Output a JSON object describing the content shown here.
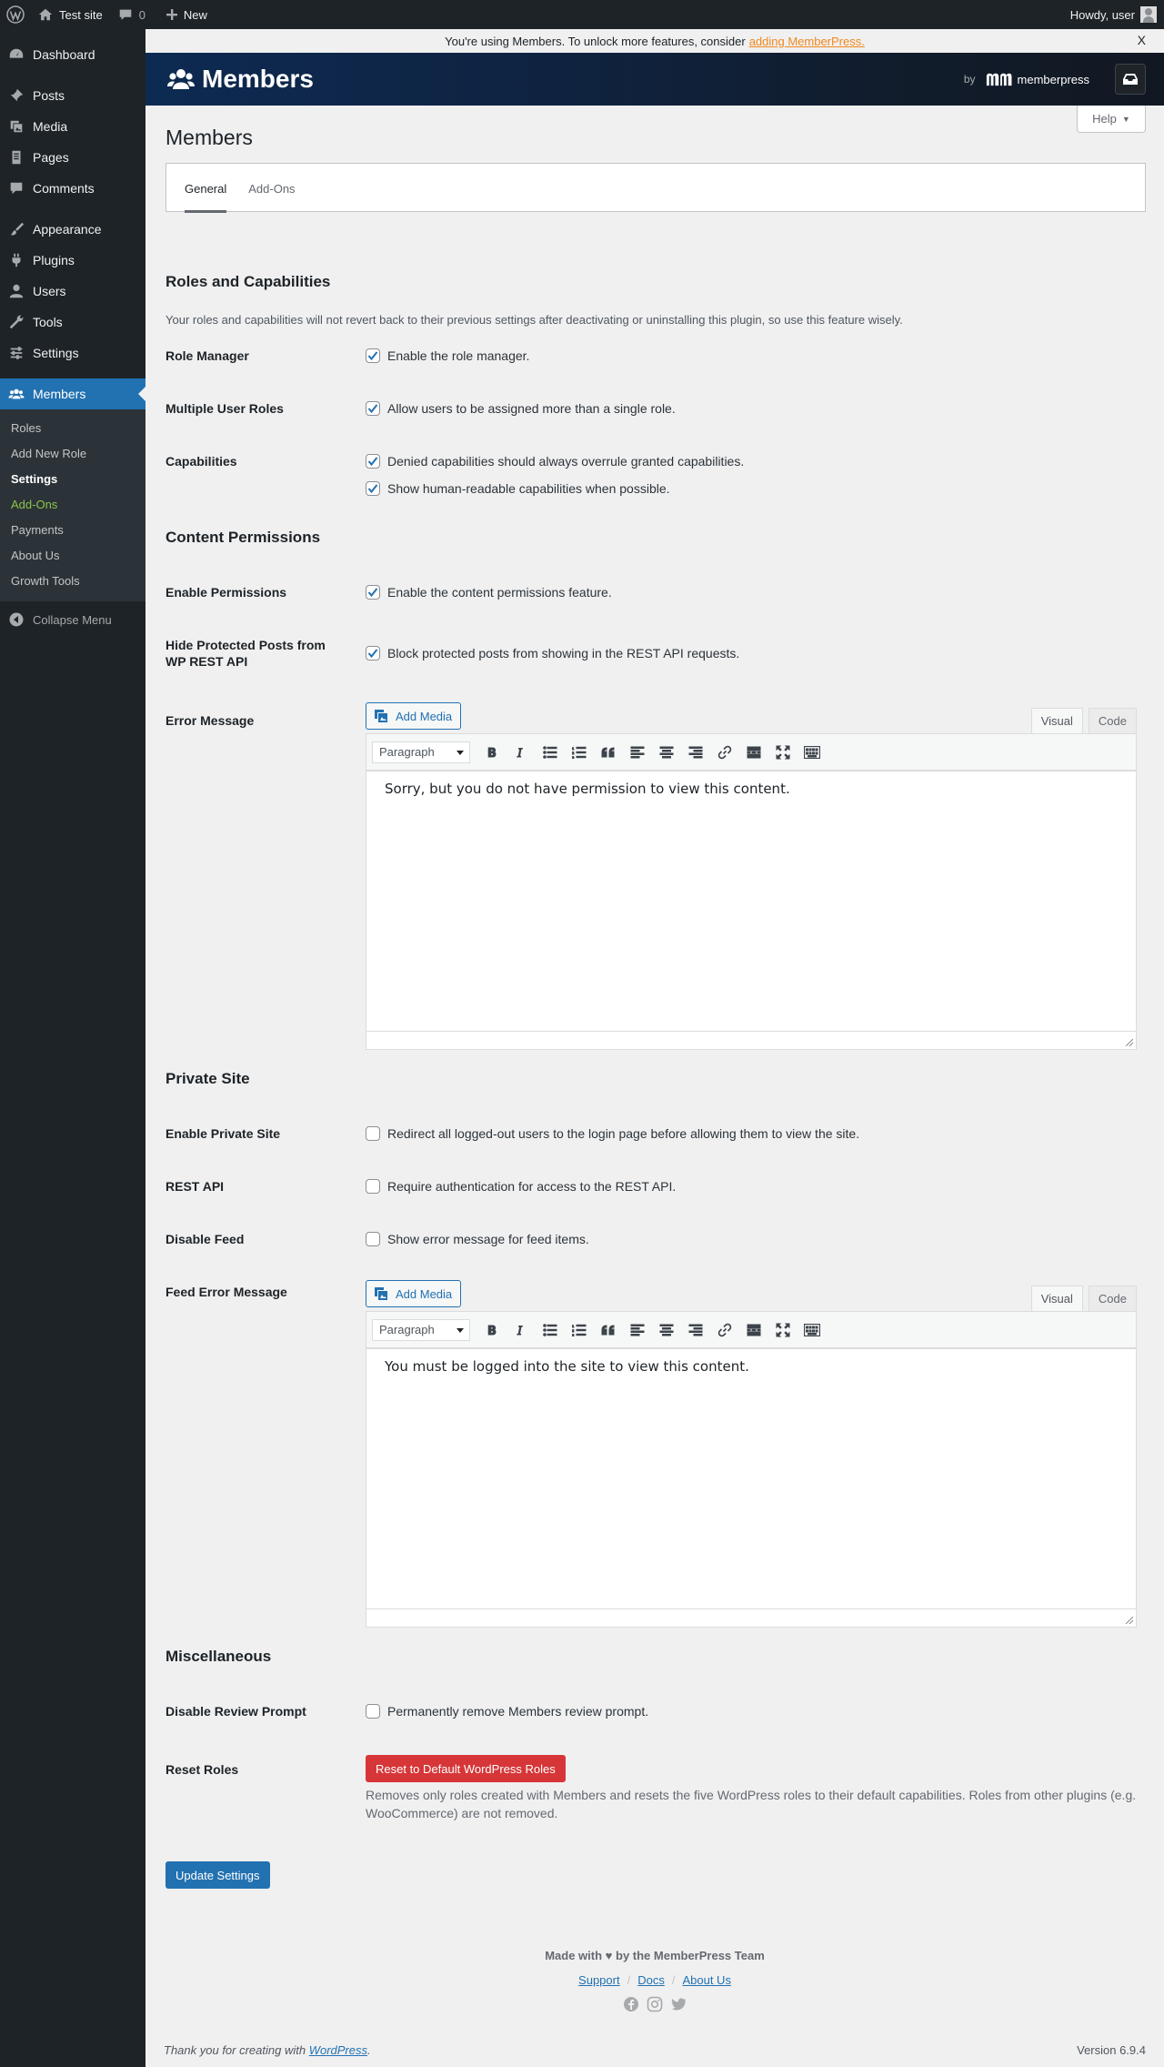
{
  "adminbar": {
    "site_name": "Test site",
    "comments_count": "0",
    "new_label": "New",
    "howdy": "Howdy, user"
  },
  "sidebar": {
    "items": [
      {
        "label": "Dashboard",
        "icon": "dashboard-icon"
      },
      {
        "label": "Posts",
        "icon": "pin-icon"
      },
      {
        "label": "Media",
        "icon": "media-icon"
      },
      {
        "label": "Pages",
        "icon": "page-icon"
      },
      {
        "label": "Comments",
        "icon": "comment-icon"
      },
      {
        "label": "Appearance",
        "icon": "brush-icon"
      },
      {
        "label": "Plugins",
        "icon": "plugin-icon"
      },
      {
        "label": "Users",
        "icon": "user-icon"
      },
      {
        "label": "Tools",
        "icon": "wrench-icon"
      },
      {
        "label": "Settings",
        "icon": "sliders-icon"
      },
      {
        "label": "Members",
        "icon": "members-icon"
      }
    ],
    "submenu": [
      "Roles",
      "Add New Role",
      "Settings",
      "Add-Ons",
      "Payments",
      "About Us",
      "Growth Tools"
    ],
    "collapse": "Collapse Menu"
  },
  "notice": {
    "text": "You're using Members. To unlock more features, consider",
    "link": "adding MemberPress.",
    "close": "X"
  },
  "brand": {
    "name": "Members",
    "by": "by",
    "partner": "memberpress"
  },
  "help_label": "Help",
  "page_title": "Members",
  "tabs": [
    "General",
    "Add-Ons"
  ],
  "sections": {
    "roles": {
      "title": "Roles and Capabilities",
      "description": "Your roles and capabilities will not revert back to their previous settings after deactivating or uninstalling this plugin, so use this feature wisely.",
      "role_manager": {
        "label": "Role Manager",
        "option": "Enable the role manager.",
        "checked": true
      },
      "multiple_roles": {
        "label": "Multiple User Roles",
        "option": "Allow users to be assigned more than a single role.",
        "checked": true
      },
      "capabilities": {
        "label": "Capabilities",
        "options": [
          {
            "text": "Denied capabilities should always overrule granted capabilities.",
            "checked": true
          },
          {
            "text": "Show human-readable capabilities when possible.",
            "checked": true
          }
        ]
      }
    },
    "content": {
      "title": "Content Permissions",
      "enable": {
        "label": "Enable Permissions",
        "option": "Enable the content permissions feature.",
        "checked": true
      },
      "hide_rest": {
        "label": "Hide Protected Posts from WP REST API",
        "option": "Block protected posts from showing in the REST API requests.",
        "checked": true
      },
      "error_message": {
        "label": "Error Message",
        "content": "Sorry, but you do not have permission to view this content."
      }
    },
    "private": {
      "title": "Private Site",
      "enable": {
        "label": "Enable Private Site",
        "option": "Redirect all logged-out users to the login page before allowing them to view the site.",
        "checked": false
      },
      "rest": {
        "label": "REST API",
        "option": "Require authentication for access to the REST API.",
        "checked": false
      },
      "feed": {
        "label": "Disable Feed",
        "option": "Show error message for feed items.",
        "checked": false
      },
      "feed_error": {
        "label": "Feed Error Message",
        "content": "You must be logged into the site to view this content."
      }
    },
    "misc": {
      "title": "Miscellaneous",
      "review": {
        "label": "Disable Review Prompt",
        "option": "Permanently remove Members review prompt.",
        "checked": false
      },
      "reset": {
        "label": "Reset Roles",
        "button": "Reset to Default WordPress Roles",
        "description": "Removes only roles created with Members and resets the five WordPress roles to their default capabilities. Roles from other plugins (e.g. WooCommerce) are not removed."
      }
    }
  },
  "editor": {
    "add_media": "Add Media",
    "visual": "Visual",
    "code": "Code",
    "format": "Paragraph"
  },
  "update_button": "Update Settings",
  "footer": {
    "credit": "Made with ♥ by the MemberPress Team",
    "links": [
      "Support",
      "Docs",
      "About Us"
    ],
    "sep": "/",
    "thanks_prefix": "Thank you for creating with",
    "thanks_link": "WordPress",
    "thanks_suffix": ".",
    "version": "Version 6.9.4"
  },
  "colors": {
    "admin_bg": "#1d2327",
    "accent": "#2271b1",
    "danger": "#d63638",
    "notice_link": "#f1881d",
    "addon_green": "#8bc34a"
  }
}
